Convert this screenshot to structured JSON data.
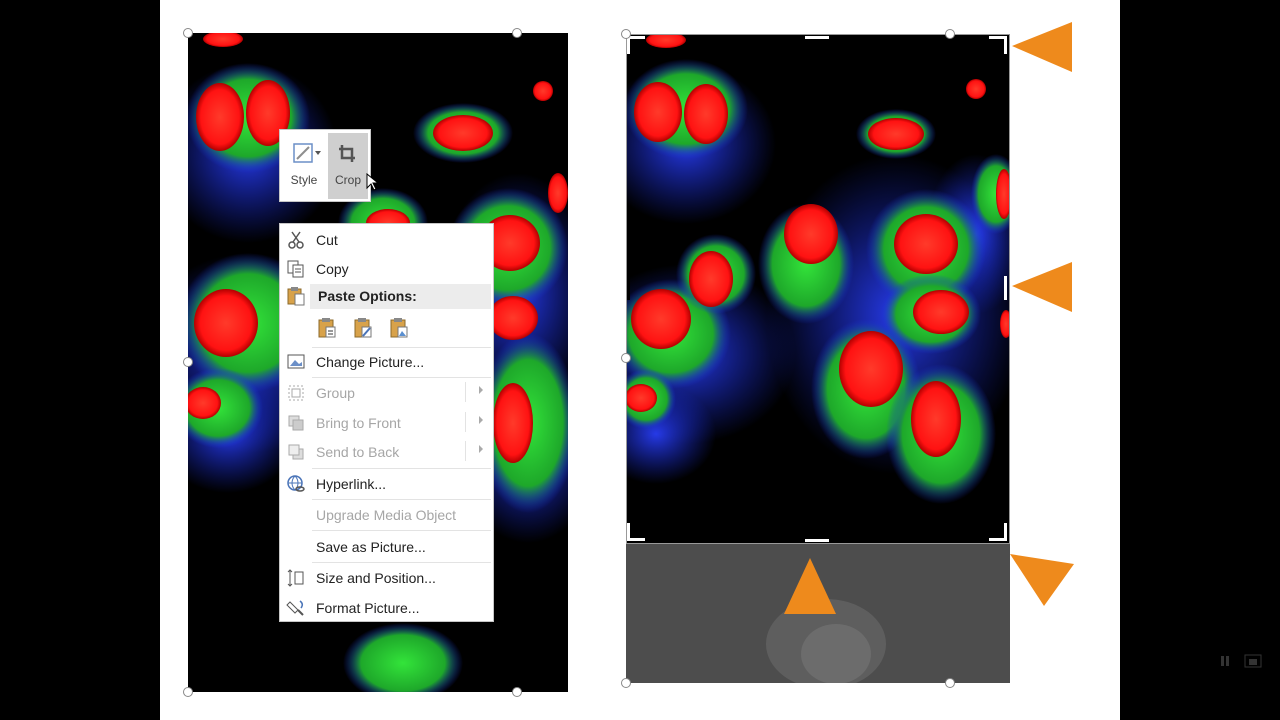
{
  "mini_toolbar": {
    "style_label": "Style",
    "crop_label": "Crop"
  },
  "context_menu": {
    "cut": "Cut",
    "copy": "Copy",
    "paste_options": "Paste Options:",
    "change_picture": "Change Picture...",
    "group": "Group",
    "bring_to_front": "Bring to Front",
    "send_to_back": "Send to Back",
    "hyperlink": "Hyperlink...",
    "upgrade_media": "Upgrade Media Object",
    "save_as_picture": "Save as Picture...",
    "size_and_position": "Size and Position...",
    "format_picture": "Format Picture..."
  },
  "colors": {
    "arrow": "#ee8a1c",
    "selection_handle": "#ffffff",
    "cell_nucleus": "#ff1a1a",
    "cytoskeleton": "#22d430",
    "membrane": "#1a2fe8"
  },
  "icons": {
    "style": "style-icon",
    "crop": "crop-icon",
    "cut": "scissors-icon",
    "copy": "copy-icon",
    "paste": "clipboard-icon"
  }
}
